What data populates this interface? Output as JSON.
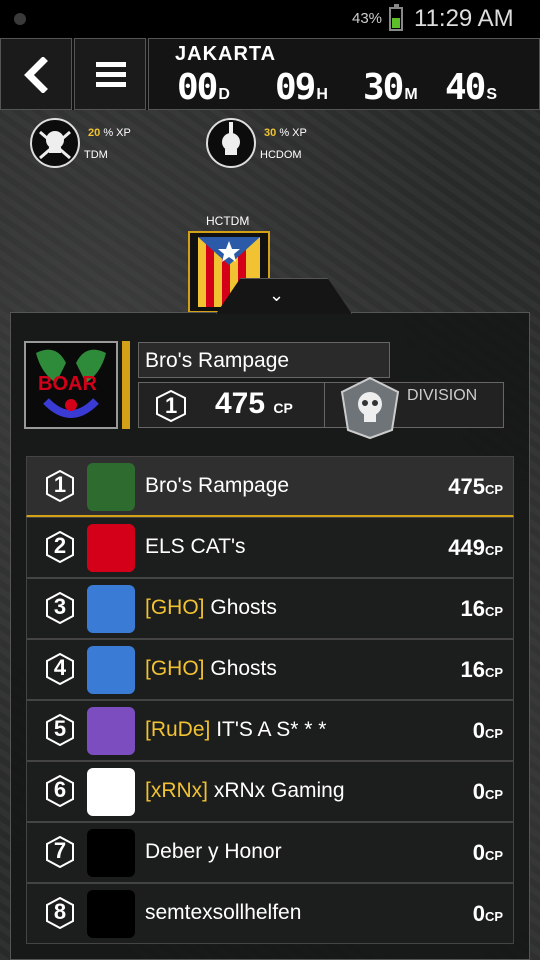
{
  "statusbar": {
    "battery_pct": "43%",
    "time": "11:29 AM"
  },
  "topbar": {
    "city": "JAKARTA",
    "countdown": [
      {
        "value": "00",
        "unit": "D"
      },
      {
        "value": "09",
        "unit": "H"
      },
      {
        "value": "30",
        "unit": "M"
      },
      {
        "value": "40",
        "unit": "S"
      }
    ]
  },
  "modes": [
    {
      "xp_pct": "20",
      "xp_label": "% XP",
      "name": "TDM"
    },
    {
      "xp_pct": "30",
      "xp_label": "% XP",
      "name": "HCDOM"
    }
  ],
  "map_label": "HCTDM",
  "clan": {
    "emblem_text": "BOAR",
    "name": "Bro's Rampage",
    "rank": "1",
    "cp": "475",
    "cp_unit": "CP",
    "division_label": "DIVISION"
  },
  "leaderboard": [
    {
      "rank": "1",
      "tag": "",
      "name": "Bro's Rampage",
      "score": "475",
      "unit": "CP",
      "logo_color": "#2e6b2e"
    },
    {
      "rank": "2",
      "tag": "",
      "name": "ELS CAT's",
      "score": "449",
      "unit": "CP",
      "logo_color": "#d4001a"
    },
    {
      "rank": "3",
      "tag": "[GHO]",
      "name": "Ghosts",
      "score": "16",
      "unit": "CP",
      "logo_color": "#3a7bd5"
    },
    {
      "rank": "4",
      "tag": "[GHO]",
      "name": "Ghosts",
      "score": "16",
      "unit": "CP",
      "logo_color": "#3a7bd5"
    },
    {
      "rank": "5",
      "tag": "[RuDe]",
      "name": "IT'S A S* * *",
      "score": "0",
      "unit": "CP",
      "logo_color": "#7c4dbf"
    },
    {
      "rank": "6",
      "tag": "[xRNx]",
      "name": "xRNx Gaming",
      "score": "0",
      "unit": "CP",
      "logo_color": "#ffffff"
    },
    {
      "rank": "7",
      "tag": "",
      "name": "Deber y Honor",
      "score": "0",
      "unit": "CP",
      "logo_color": "#000000"
    },
    {
      "rank": "8",
      "tag": "",
      "name": "semtexsollhelfen",
      "score": "0",
      "unit": "CP",
      "logo_color": "#000000"
    }
  ],
  "colors": {
    "accent_gold": "#d4a017",
    "tag_yellow": "#f1c232"
  }
}
